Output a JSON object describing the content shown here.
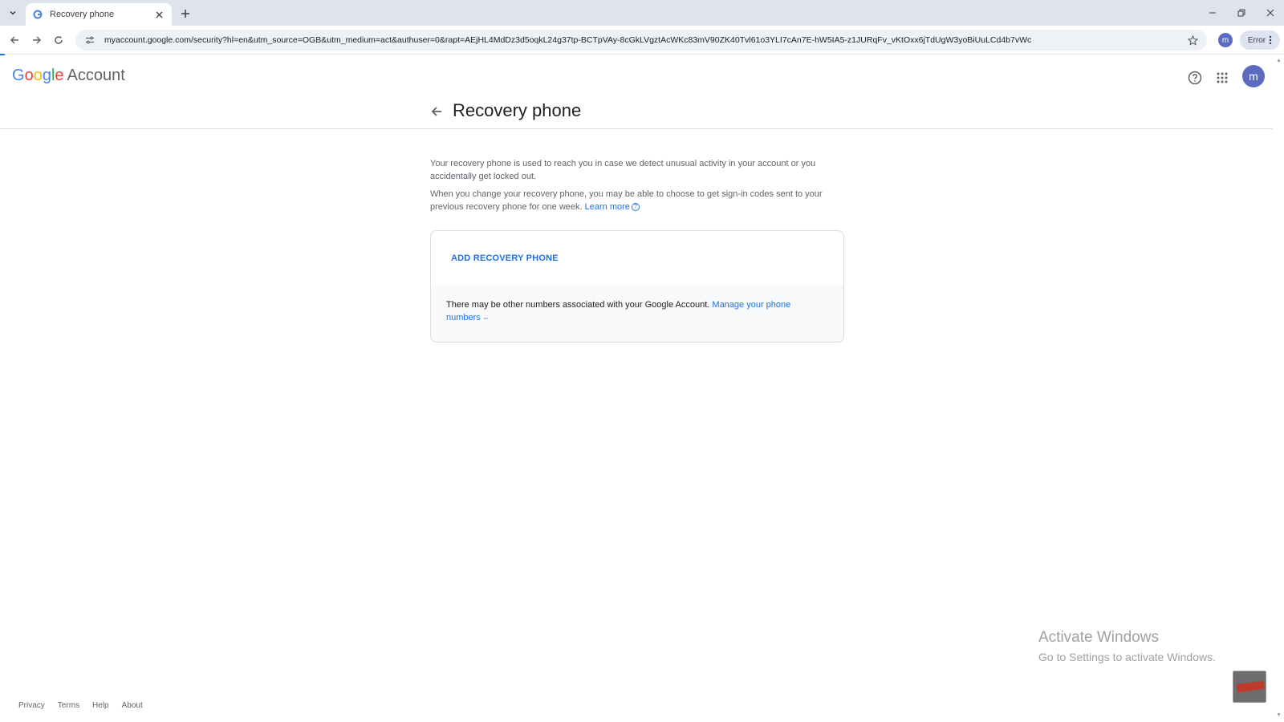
{
  "browser": {
    "tab_title": "Recovery phone",
    "url": "myaccount.google.com/security?hl=en&utm_source=OGB&utm_medium=act&authuser=0&rapt=AEjHL4MdDz3d5oqkL24g37tp-BCTpVAy-8cGkLVgztAcWKc83mV90ZK40Tvl61o3YLI7cAn7E-hW5IA5-z1JURqFv_vKtOxx6jTdUgW3yoBiUuLCd4b7vWc",
    "profile_letter": "m",
    "error_label": "Error"
  },
  "header": {
    "logo_g1": "G",
    "logo_o1": "o",
    "logo_o2": "o",
    "logo_g2": "g",
    "logo_l": "l",
    "logo_e": "e",
    "logo_account": "Account",
    "avatar_letter": "m",
    "page_title": "Recovery phone"
  },
  "main": {
    "para1": "Your recovery phone is used to reach you in case we detect unusual activity in your account or you accidentally get locked out.",
    "para2": "When you change your recovery phone, you may be able to choose to get sign-in codes sent to your previous recovery phone for one week.",
    "learn_more": "Learn more",
    "add_label": "ADD RECOVERY PHONE",
    "note": "There may be other numbers associated with your Google Account.",
    "manage_link": "Manage your phone numbers"
  },
  "footer": {
    "privacy": "Privacy",
    "terms": "Terms",
    "help": "Help",
    "about": "About"
  },
  "watermark": {
    "title": "Activate Windows",
    "subtitle": "Go to Settings to activate Windows."
  }
}
